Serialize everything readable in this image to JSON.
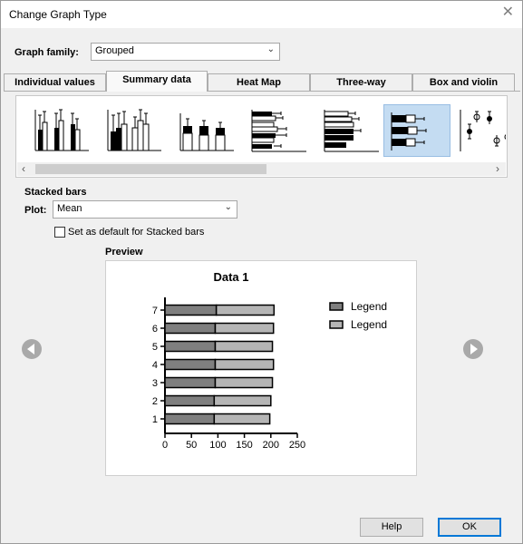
{
  "window": {
    "title": "Change Graph Type",
    "close_glyph": "✕"
  },
  "graph_family": {
    "label": "Graph family:",
    "value": "Grouped"
  },
  "tabs": [
    {
      "label": "Individual values"
    },
    {
      "label": "Summary data",
      "active": true
    },
    {
      "label": "Heat Map"
    },
    {
      "label": "Three-way"
    },
    {
      "label": "Box and violin"
    }
  ],
  "gallery": {
    "thumbnails": [
      "grouped-bars-open",
      "grouped-bars-mixed",
      "stacked-bars-vertical",
      "grouped-horizontal-bars-error",
      "stacked-horizontal-bars",
      "stacked-horizontal-bars-selected",
      "interleaved-scatter"
    ],
    "selected_index": 5
  },
  "section": {
    "title": "Stacked bars",
    "plot_label": "Plot:",
    "plot_value": "Mean",
    "default_checkbox_label": "Set as default for Stacked bars",
    "default_checked": false
  },
  "preview": {
    "label": "Preview"
  },
  "chart_data": {
    "type": "bar",
    "orientation": "horizontal",
    "stacked": true,
    "title": "Data 1",
    "categories": [
      "1",
      "2",
      "3",
      "4",
      "5",
      "6",
      "7"
    ],
    "series": [
      {
        "name": "Legend",
        "values": [
          93,
          93,
          95,
          95,
          95,
          95,
          97
        ],
        "color": "#7f7f7f"
      },
      {
        "name": "Legend",
        "values": [
          105,
          107,
          108,
          110,
          108,
          110,
          109
        ],
        "color": "#b5b5b5"
      }
    ],
    "xlim": [
      0,
      250
    ],
    "xticks": [
      "0",
      "50",
      "100",
      "150",
      "200",
      "250"
    ]
  },
  "buttons": {
    "help": "Help",
    "ok": "OK"
  },
  "colors": {
    "selection": "#c4dcf2",
    "ok_border": "#0078d7",
    "nav_circle": "#a9a9a9"
  }
}
